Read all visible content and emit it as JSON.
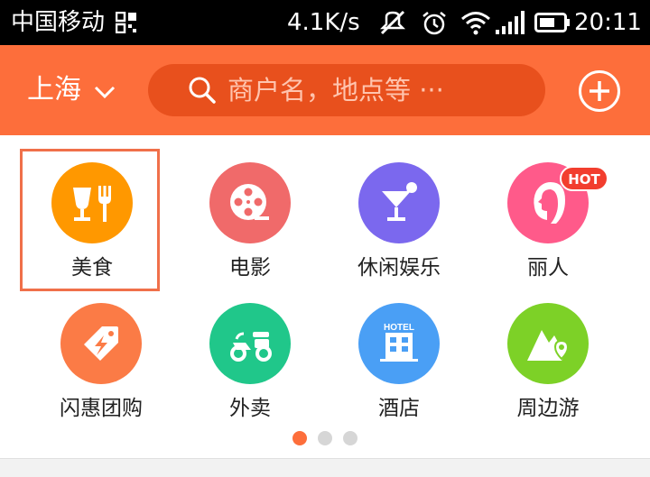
{
  "status_bar": {
    "carrier": "中国移动",
    "speed": "4.1K/s",
    "time": "20:11",
    "icons": [
      "qr-icon",
      "mute-icon",
      "alarm-icon",
      "wifi-icon",
      "signal-icon",
      "battery-icon"
    ]
  },
  "header": {
    "city": "上海",
    "search_placeholder": "商户名，地点等 ···",
    "accent_color": "#fd6e3b"
  },
  "categories": [
    {
      "label": "美食",
      "icon": "food-icon",
      "color": "#ff9800",
      "selected": true
    },
    {
      "label": "电影",
      "icon": "film-reel-icon",
      "color": "#f06a6a"
    },
    {
      "label": "休闲娱乐",
      "icon": "cocktail-icon",
      "color": "#7b68ee"
    },
    {
      "label": "丽人",
      "icon": "woman-profile-icon",
      "color": "#ff5a8a",
      "badge": "HOT"
    },
    {
      "label": "闪惠团购",
      "icon": "flash-tag-icon",
      "color": "#fb7b46"
    },
    {
      "label": "外卖",
      "icon": "scooter-icon",
      "color": "#20c78a"
    },
    {
      "label": "酒店",
      "icon": "hotel-icon",
      "color": "#4a9ff5",
      "icon_text": "HOTEL"
    },
    {
      "label": "周边游",
      "icon": "mountain-pin-icon",
      "color": "#7dd127"
    }
  ],
  "pager": {
    "pages": 3,
    "current": 1
  }
}
